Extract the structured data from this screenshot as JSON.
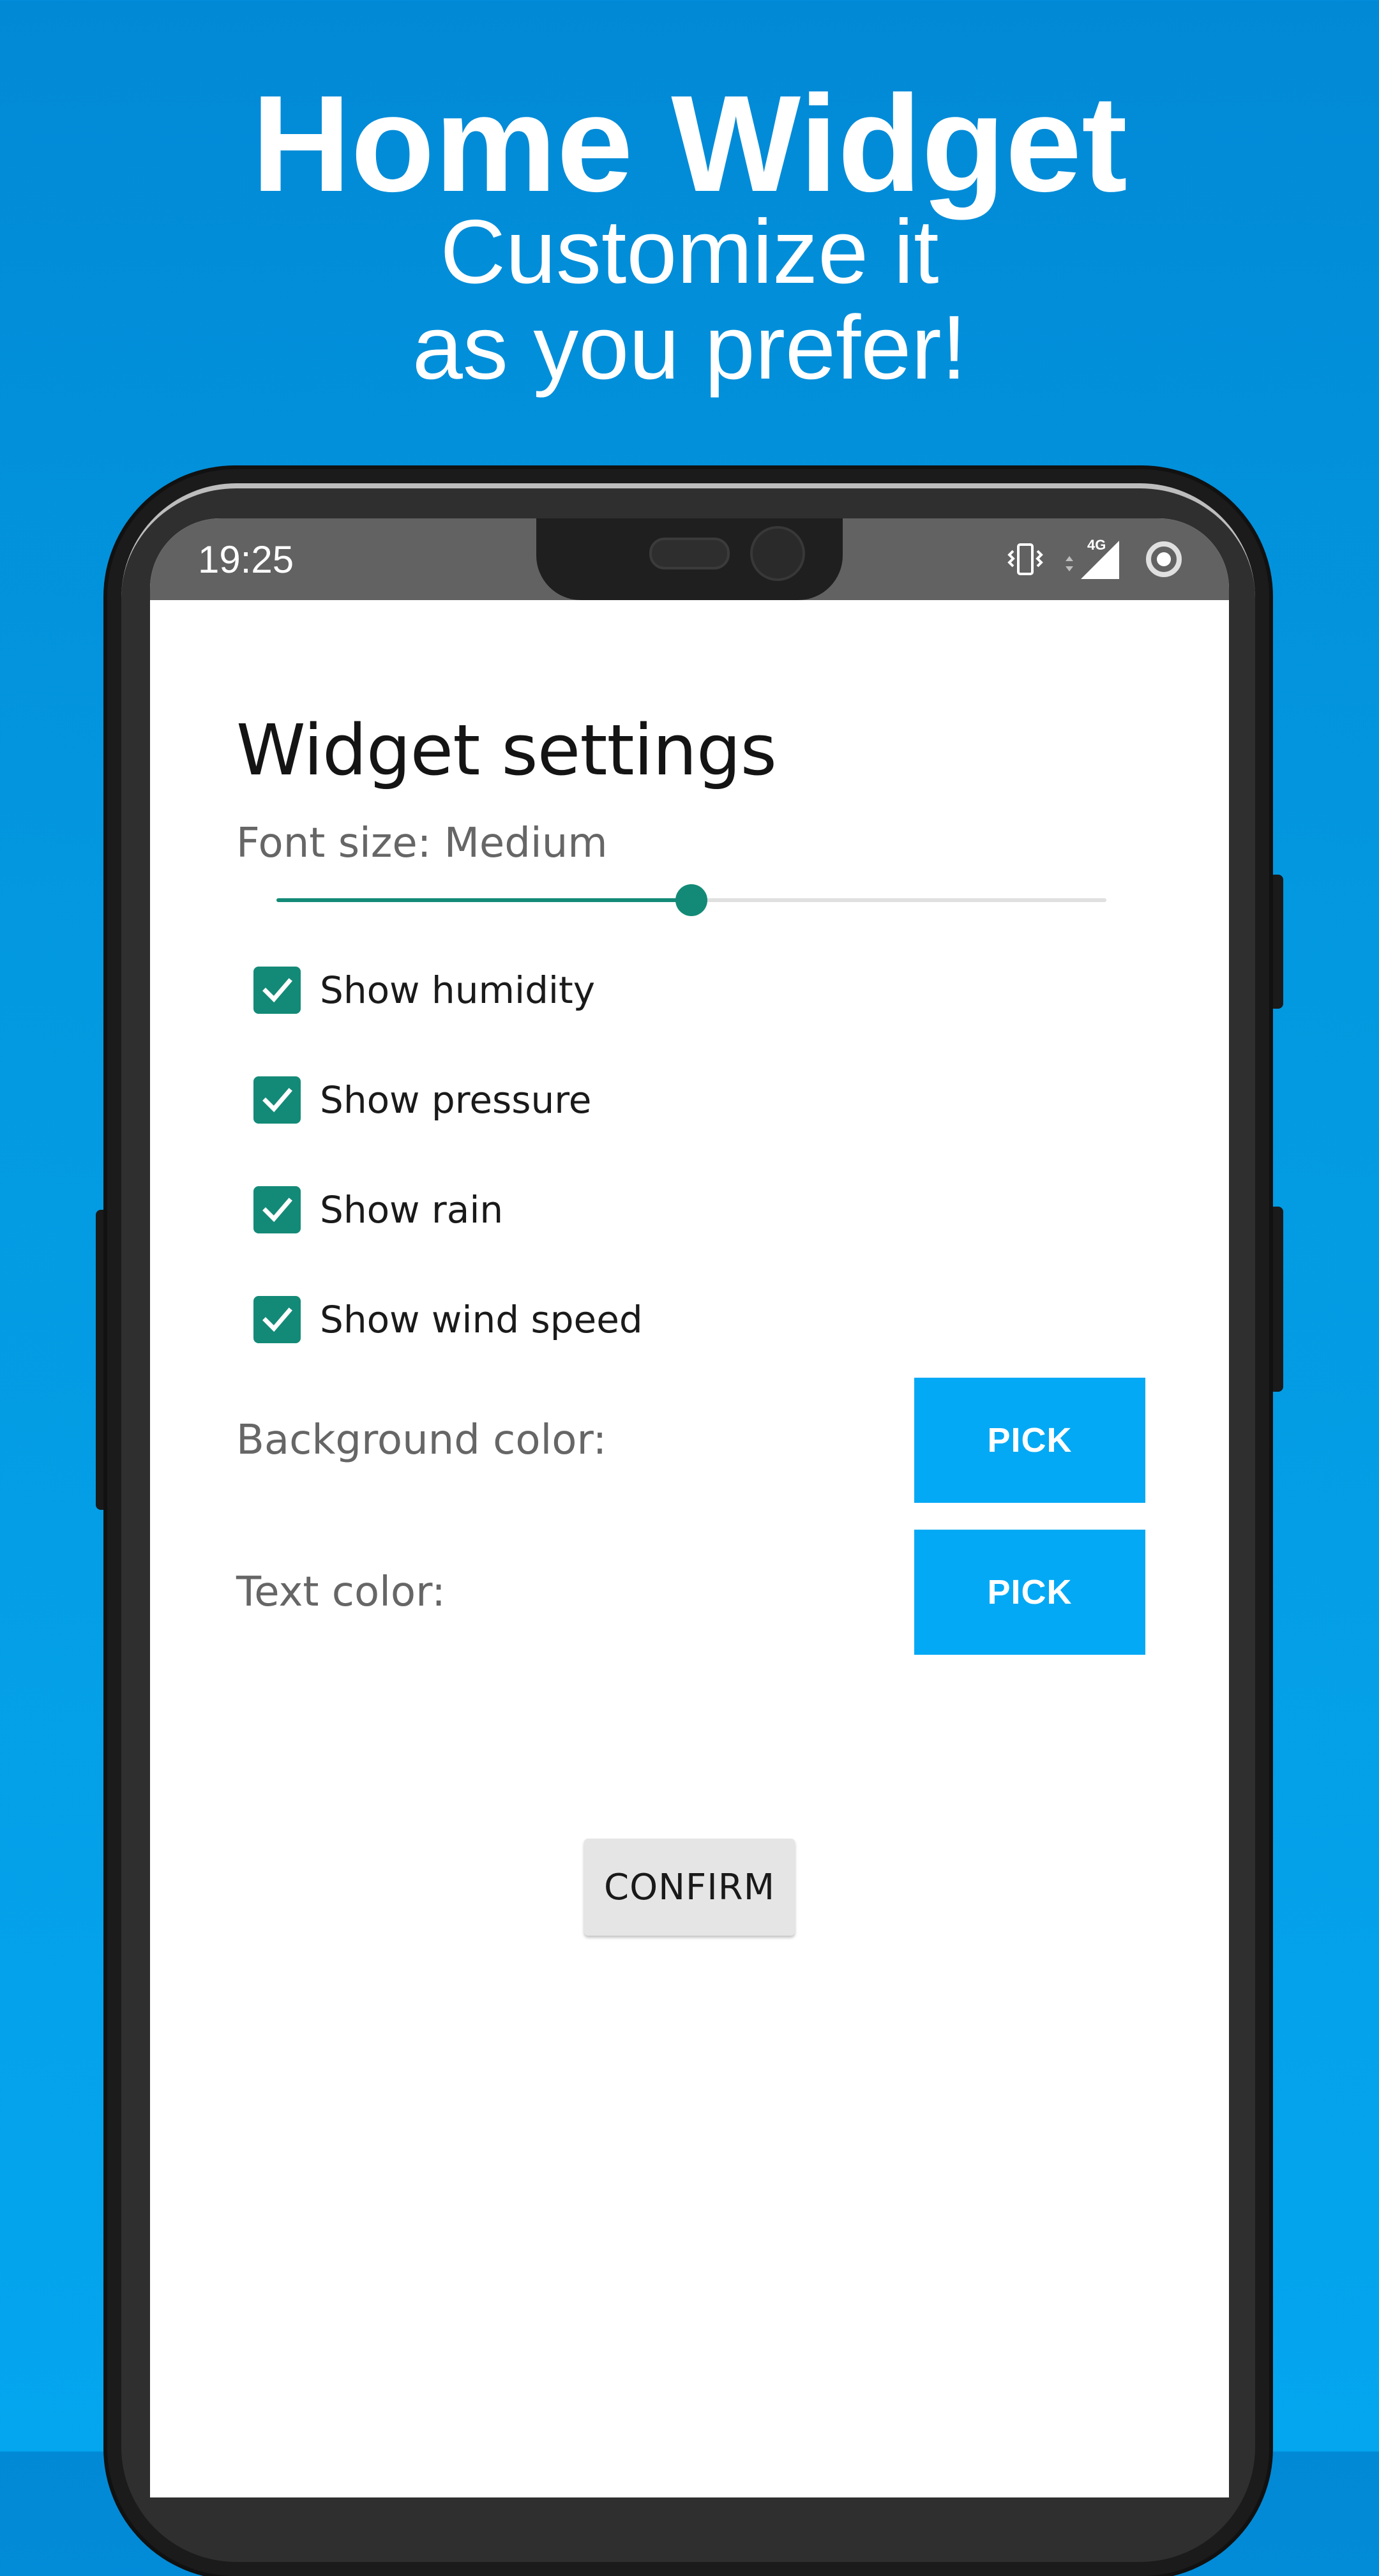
{
  "promo": {
    "title": "Home Widget",
    "subtitle_line1": "Customize it",
    "subtitle_line2": "as you prefer!"
  },
  "status_bar": {
    "time": "19:25",
    "network_label": "4G",
    "icons": [
      "vibrate-icon",
      "data-arrows-icon",
      "signal-icon",
      "sync-icon"
    ]
  },
  "settings": {
    "title": "Widget settings",
    "font_size_label": "Font size: Medium",
    "font_size_slider": {
      "value_fraction": 0.5
    },
    "checkboxes": [
      {
        "label": "Show humidity",
        "checked": true
      },
      {
        "label": "Show pressure",
        "checked": true
      },
      {
        "label": "Show rain",
        "checked": true
      },
      {
        "label": "Show wind speed",
        "checked": true
      }
    ],
    "background_color": {
      "label": "Background color:",
      "button_label": "PICK"
    },
    "text_color": {
      "label": "Text color:",
      "button_label": "PICK"
    },
    "confirm_label": "CONFIRM"
  },
  "colors": {
    "background": "#0399e0",
    "accent": "#138a77",
    "pick_button": "#03a9f4",
    "confirm_button": "#e5e5e5"
  }
}
